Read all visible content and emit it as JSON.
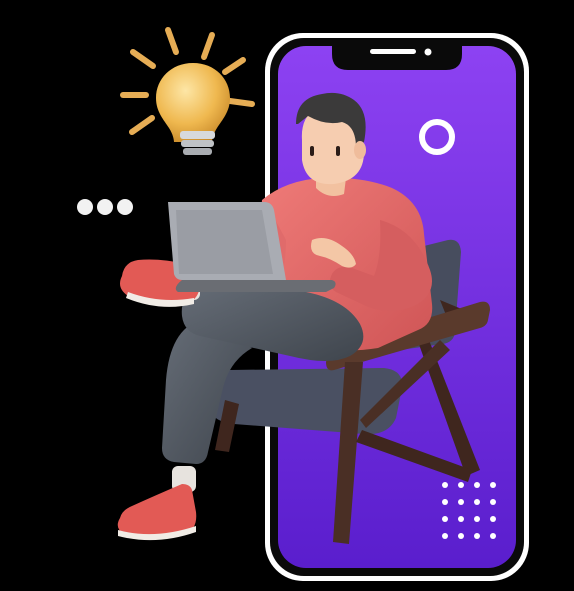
{
  "scene": {
    "subject": "person-with-laptop-on-armchair",
    "icons": [
      "lightbulb-icon",
      "typing-dots-icon",
      "ring-icon",
      "dot-grid-icon"
    ]
  },
  "colors": {
    "background": "#000000",
    "phone_screen_top": "#8a3df0",
    "phone_screen_bottom": "#5b1fcf",
    "phone_frame": "#ffffff",
    "sweater": "#e56a6a",
    "pants": "#4f5660",
    "chair_wood": "#4a2f25",
    "chair_cushion": "#4a5062",
    "shoes": "#e25a55",
    "bulb": "#f2c160",
    "laptop": "#a9acb3"
  }
}
